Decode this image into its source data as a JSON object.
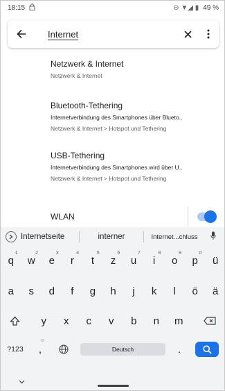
{
  "status_bar": {
    "time": "18:15",
    "left_icon": "lock-icon",
    "right_icons": "⊖ ▼◢ ▮",
    "battery": "49 %"
  },
  "search": {
    "query": "Internet",
    "back_icon": "arrow-back-icon",
    "clear_icon": "close-icon",
    "more_icon": "more-vert-icon"
  },
  "results": [
    {
      "title": "Netzwerk & Internet",
      "summary": "",
      "path": "Netzwerk & Internet"
    },
    {
      "title": "Bluetooth-Tethering",
      "summary": "Internetverbindung des Smartphones über Blueto..",
      "path": "Netzwerk & Internet > Hotspot und Tethering"
    },
    {
      "title": "USB-Tethering",
      "summary": "Internetverbindung des Smartphones wird über U..",
      "path": "Netzwerk & Internet > Hotspot und Tethering"
    }
  ],
  "wlan": {
    "label": "WLAN",
    "enabled": true
  },
  "keyboard": {
    "suggestions": [
      "Internetseite",
      "interner",
      "Internet...chluss"
    ],
    "row1": [
      {
        "k": "q",
        "n": "1"
      },
      {
        "k": "w",
        "n": "2"
      },
      {
        "k": "e",
        "n": "3"
      },
      {
        "k": "r",
        "n": "4"
      },
      {
        "k": "t",
        "n": "5"
      },
      {
        "k": "z",
        "n": "6"
      },
      {
        "k": "u",
        "n": "7"
      },
      {
        "k": "i",
        "n": "8"
      },
      {
        "k": "o",
        "n": "9"
      },
      {
        "k": "p",
        "n": "0"
      },
      {
        "k": "ü",
        "n": ""
      }
    ],
    "row2": [
      "a",
      "s",
      "d",
      "f",
      "g",
      "h",
      "j",
      "k",
      "l",
      "ö",
      "ä"
    ],
    "row3": [
      "y",
      "x",
      "c",
      "v",
      "b",
      "n",
      "m"
    ],
    "symbols_label": "?123",
    "comma": ",",
    "space_label": "Deutsch",
    "period": ".",
    "shift_icon": "shift-icon",
    "backspace_icon": "backspace-icon",
    "globe_icon": "globe-icon",
    "emoji_icon": "emoji-icon",
    "search_icon": "search-icon",
    "mic_icon": "mic-icon"
  },
  "nav": {
    "chevron_icon": "chevron-down-icon"
  }
}
